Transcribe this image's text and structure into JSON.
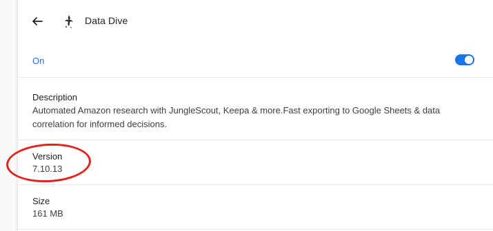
{
  "header": {
    "back_icon": "arrow-left-icon",
    "extension_icon": "bird-logo-icon",
    "title": "Data Dive"
  },
  "enabled": {
    "label": "On",
    "toggle_state": "on",
    "accent_color": "#1a73e8"
  },
  "description": {
    "label": "Description",
    "text_line1": "Automated Amazon research with JungleScout, Keepa & more.Fast exporting to Google Sheets & data",
    "text_line2": "correlation for informed decisions."
  },
  "version": {
    "label": "Version",
    "value": "7.10.13"
  },
  "size": {
    "label": "Size",
    "value": "161 MB"
  },
  "annotation": {
    "color": "#e3231a",
    "target": "version"
  }
}
